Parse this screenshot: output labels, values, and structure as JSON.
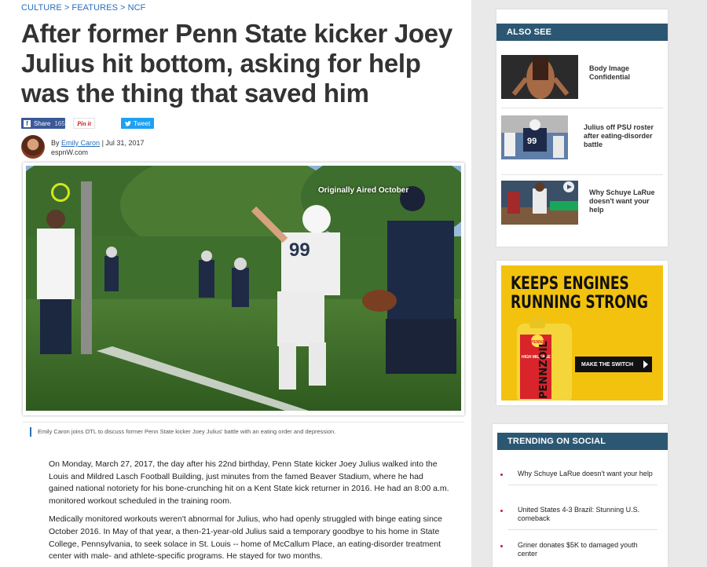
{
  "breadcrumb": {
    "items": [
      "CULTURE",
      "FEATURES",
      "NCF"
    ],
    "separator": ">"
  },
  "headline": "After former Penn State kicker Joey Julius hit bottom, asking for help was the thing that saved him",
  "share": {
    "facebook_label": "Share",
    "facebook_count": "165",
    "pinterest_label": "Pin it",
    "twitter_label": "Tweet"
  },
  "byline": {
    "prefix": "By",
    "author": "Emily Caron",
    "separator": "|",
    "date": "Jul 31, 2017",
    "outlet": "espnW.com"
  },
  "video": {
    "overlay_text": "Originally Aired October"
  },
  "caption": "Emily Caron joins OTL to discuss former Penn State kicker Joey Julius' battle with an eating order and depression.",
  "article": {
    "paragraphs": [
      "On Monday, March 27, 2017, the day after his 22nd birthday, Penn State kicker Joey Julius walked into the Louis and Mildred Lasch Football Building, just minutes from the famed Beaver Stadium, where he had gained national notoriety for his bone-crunching hit on a Kent State kick returner in 2016. He had an 8:00 a.m. monitored workout scheduled in the training room.",
      "Medically monitored workouts weren't abnormal for Julius, who had openly struggled with binge eating since October 2016. In May of that year, a then-21-year-old Julius said a temporary goodbye to his home in State College, Pennsylvania, to seek solace in St. Louis -- home of McCallum Place, an eating-disorder treatment center with male- and athlete-specific programs. He stayed for two months."
    ]
  },
  "also_see": {
    "title": "ALSO SEE",
    "items": [
      {
        "title": "Body Image Confidential",
        "icon": "body-image-thumbnail"
      },
      {
        "title": "Julius off PSU roster after eating-disorder battle",
        "icon": "julius-thumbnail"
      },
      {
        "title": "Why Schuye LaRue doesn't want your help",
        "icon": "larue-thumbnail"
      }
    ]
  },
  "ad": {
    "headline_line1": "KEEPS ENGINES",
    "headline_line2": "RUNNING STRONG",
    "cta": "MAKE THE SWITCH",
    "brand": "PENNZOIL",
    "bottle_label": "HIGH MILEAGE"
  },
  "trending": {
    "title": "TRENDING ON SOCIAL",
    "items": [
      "Why Schuye LaRue doesn't want your help",
      "United States 4-3 Brazil: Stunning U.S. comeback",
      "Griner donates $5K to damaged youth center"
    ]
  },
  "colors": {
    "link": "#2a6ebb",
    "header_bar": "#2b5773",
    "ad_yellow": "#f2c20f",
    "facebook": "#3b5998",
    "twitter": "#1da1f2"
  }
}
